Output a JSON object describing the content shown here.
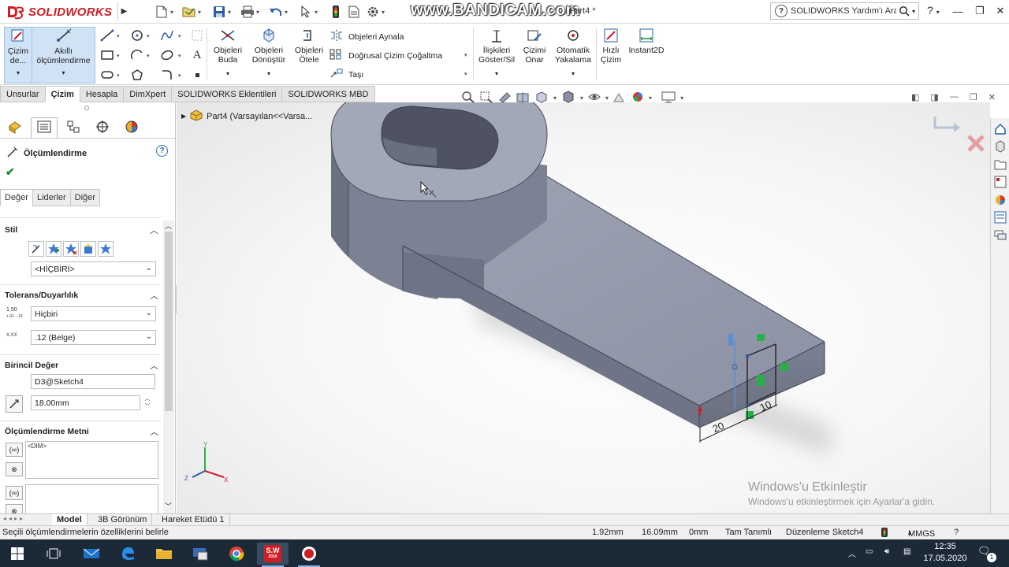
{
  "app": {
    "logo_text": "SOLIDWORKS",
    "doc_title": "Part4 *",
    "watermark": "www.BANDICAM.com",
    "search_placeholder": "SOLIDWORKS Yardım'ı Ara",
    "help": "?"
  },
  "ribbon": {
    "sketch_btn": "Çizim de...",
    "smart_dim_btn": "Akıllı ölçümlendirme",
    "trim": "Objeleri Buda",
    "convert": "Objeleri Dönüştür",
    "offset": "Objeleri Ötele",
    "mirror": "Objeleri Aynala",
    "linear_pattern": "Doğrusal Çizim Çoğaltma",
    "move": "Taşı",
    "relations": "İlişkileri Göster/Sil",
    "repair": "Çizimi Onar",
    "snap": "Otomatik Yakalama",
    "rapid": "Hızlı Çizim",
    "instant2d": "Instant2D"
  },
  "tabs": [
    "Unsurlar",
    "Çizim",
    "Hesapla",
    "DimXpert",
    "SOLIDWORKS Eklentileri",
    "SOLIDWORKS MBD"
  ],
  "active_tab": "Çizim",
  "panel": {
    "title": "Ölçümlendirme",
    "subtabs": [
      "Değer",
      "Liderler",
      "Diğer"
    ],
    "style_head": "Stil",
    "style_combo": "<HİÇBİRİ>",
    "tol_head": "Tolerans/Duyarlılık",
    "tol_combo": "Hiçbiri",
    "precision_combo": ".12 (Belge)",
    "primary_head": "Birincil Değer",
    "primary_name": "D3@Sketch4",
    "primary_value": "18.00mm",
    "text_head": "Ölçümlendirme Metni",
    "dim_text": "<DIM>",
    "tol_icon_top": "1.50",
    "tol_icon_pm": "+.01 −.01",
    "prec_icon": "X.XX"
  },
  "viewport": {
    "tree_item": "Part4  (Varsayılan<<Varsa...",
    "dim_20": "20",
    "dim_10": "10",
    "activate_title": "Windows'u Etkinleştir",
    "activate_sub": "Windows'u etkinleştirmek için Ayarlar'a gidin."
  },
  "bottom_tabs": [
    "Model",
    "3B Görünüm",
    "Hareket Etüdü 1"
  ],
  "status": {
    "message": "Seçili ölçümlendirmelerin özelliklerini belirle",
    "x": "1.92mm",
    "y": "16.09mm",
    "z": "0mm",
    "state": "Tam Tanımlı",
    "editing": "Düzenleme Sketch4",
    "units": "MMGS"
  },
  "taskbar": {
    "time": "12:35",
    "date": "17.05.2020",
    "sw_badge": "2016"
  },
  "colors": {
    "accent": "#d21c24",
    "selected": "#cfe3f5",
    "part": "#8a8fa0",
    "taskbar": "#1c2a38"
  }
}
